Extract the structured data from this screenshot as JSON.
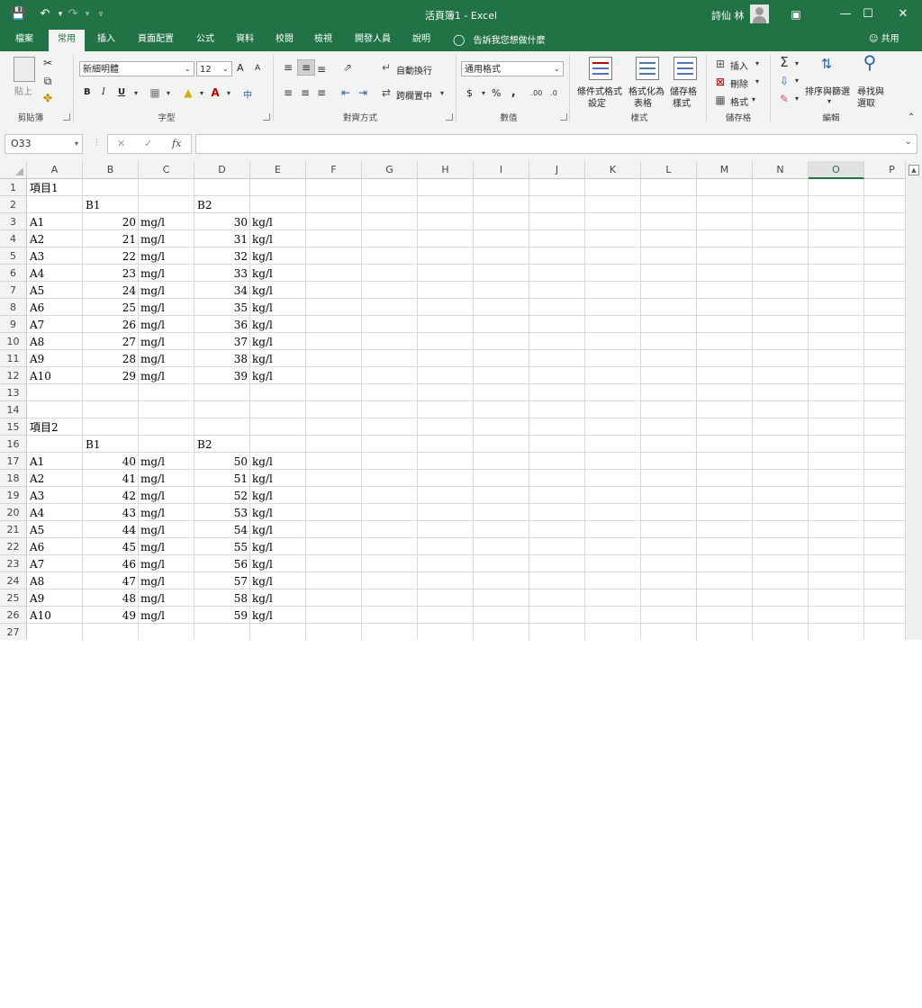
{
  "titlebar": {
    "title": "活頁簿1  -  Excel",
    "user": "詩仙 林",
    "save_icon": "save-icon",
    "undo_icon": "undo-icon",
    "redo_icon": "redo-icon",
    "customize_icon": "customize-qat-icon",
    "ribbon_display_icon": "ribbon-display-options-icon",
    "minimize": "—",
    "restore": "☐",
    "close": "✕"
  },
  "tabs": [
    "檔案",
    "常用",
    "插入",
    "頁面配置",
    "公式",
    "資料",
    "校閱",
    "檢視",
    "開發人員",
    "說明"
  ],
  "active_tab": "常用",
  "tell_me": "告訴我您想做什麼",
  "share": "共用",
  "ribbon": {
    "clipboard": {
      "label": "剪貼簿",
      "paste": "貼上"
    },
    "font": {
      "label": "字型",
      "font_name": "新細明體",
      "font_size": "12",
      "grow": "A",
      "shrink": "A",
      "bold": "B",
      "italic": "I",
      "underline": "U",
      "phonetic": "中"
    },
    "alignment": {
      "label": "對齊方式",
      "wrap": "自動換行",
      "merge": "跨欄置中"
    },
    "number": {
      "label": "數值",
      "format": "通用格式",
      "currency": "$",
      "percent": "%",
      "comma": ","
    },
    "styles": {
      "label": "樣式",
      "conditional": [
        "條件式格式",
        "設定"
      ],
      "table": [
        "格式化為",
        "表格"
      ],
      "cell_styles": [
        "儲存格",
        "樣式"
      ]
    },
    "cells": {
      "label": "儲存格",
      "insert": "插入",
      "delete": "刪除",
      "format": "格式"
    },
    "editing": {
      "label": "編輯",
      "sort": "排序與篩選",
      "find": [
        "尋找與",
        "選取"
      ]
    }
  },
  "formula_bar": {
    "name_box": "O33",
    "cancel": "✕",
    "enter": "✓",
    "fx": "fx",
    "value": ""
  },
  "columns": [
    "A",
    "B",
    "C",
    "D",
    "E",
    "F",
    "G",
    "H",
    "I",
    "J",
    "K",
    "L",
    "M",
    "N",
    "O",
    "P"
  ],
  "selected_column": "O",
  "rows": [
    "1",
    "2",
    "3",
    "4",
    "5",
    "6",
    "7",
    "8",
    "9",
    "10",
    "11",
    "12",
    "13",
    "14",
    "15",
    "16",
    "17",
    "18",
    "19",
    "20",
    "21",
    "22",
    "23",
    "24",
    "25",
    "26",
    "27"
  ],
  "sheet": {
    "item1": {
      "title": "項目1",
      "header_b": "B1",
      "header_d": "B2",
      "rows": [
        {
          "a": "A1",
          "b": "20",
          "c": "mg/l",
          "d": "30",
          "e": "kg/l"
        },
        {
          "a": "A2",
          "b": "21",
          "c": "mg/l",
          "d": "31",
          "e": "kg/l"
        },
        {
          "a": "A3",
          "b": "22",
          "c": "mg/l",
          "d": "32",
          "e": "kg/l"
        },
        {
          "a": "A4",
          "b": "23",
          "c": "mg/l",
          "d": "33",
          "e": "kg/l"
        },
        {
          "a": "A5",
          "b": "24",
          "c": "mg/l",
          "d": "34",
          "e": "kg/l"
        },
        {
          "a": "A6",
          "b": "25",
          "c": "mg/l",
          "d": "35",
          "e": "kg/l"
        },
        {
          "a": "A7",
          "b": "26",
          "c": "mg/l",
          "d": "36",
          "e": "kg/l"
        },
        {
          "a": "A8",
          "b": "27",
          "c": "mg/l",
          "d": "37",
          "e": "kg/l"
        },
        {
          "a": "A9",
          "b": "28",
          "c": "mg/l",
          "d": "38",
          "e": "kg/l"
        },
        {
          "a": "A10",
          "b": "29",
          "c": "mg/l",
          "d": "39",
          "e": "kg/l"
        }
      ]
    },
    "item2": {
      "title": "項目2",
      "header_b": "B1",
      "header_d": "B2",
      "rows": [
        {
          "a": "A1",
          "b": "40",
          "c": "mg/l",
          "d": "50",
          "e": "kg/l"
        },
        {
          "a": "A2",
          "b": "41",
          "c": "mg/l",
          "d": "51",
          "e": "kg/l"
        },
        {
          "a": "A3",
          "b": "42",
          "c": "mg/l",
          "d": "52",
          "e": "kg/l"
        },
        {
          "a": "A4",
          "b": "43",
          "c": "mg/l",
          "d": "53",
          "e": "kg/l"
        },
        {
          "a": "A5",
          "b": "44",
          "c": "mg/l",
          "d": "54",
          "e": "kg/l"
        },
        {
          "a": "A6",
          "b": "45",
          "c": "mg/l",
          "d": "55",
          "e": "kg/l"
        },
        {
          "a": "A7",
          "b": "46",
          "c": "mg/l",
          "d": "56",
          "e": "kg/l"
        },
        {
          "a": "A8",
          "b": "47",
          "c": "mg/l",
          "d": "57",
          "e": "kg/l"
        },
        {
          "a": "A9",
          "b": "48",
          "c": "mg/l",
          "d": "58",
          "e": "kg/l"
        },
        {
          "a": "A10",
          "b": "49",
          "c": "mg/l",
          "d": "59",
          "e": "kg/l"
        }
      ]
    }
  },
  "colors": {
    "brand": "#217346",
    "grid_line": "#dadada",
    "header_bg": "#f3f3f3"
  }
}
